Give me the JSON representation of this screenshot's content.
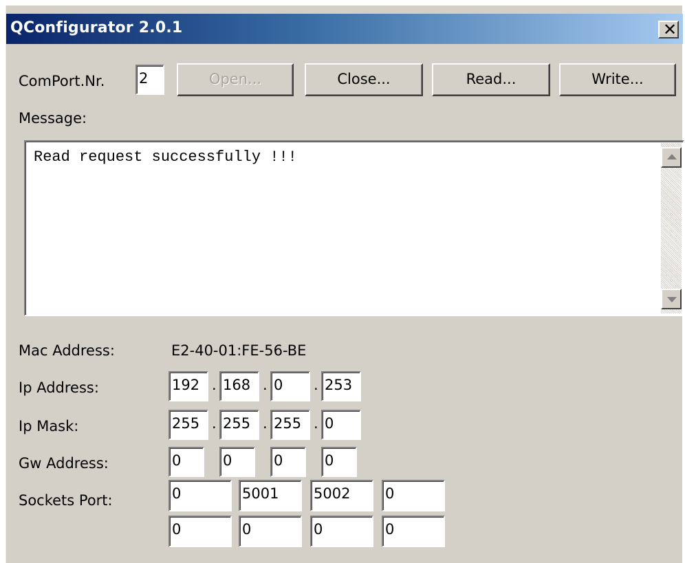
{
  "window": {
    "title": "QConfigurator 2.0.1",
    "close_glyph": "✕"
  },
  "com": {
    "label": "ComPort.Nr.",
    "value": "2",
    "buttons": {
      "open": "Open...",
      "close": "Close...",
      "read": "Read...",
      "write": "Write..."
    }
  },
  "message": {
    "label": "Message:",
    "text": "Read request successfully !!!"
  },
  "mac": {
    "label": "Mac Address:",
    "value": "E2-40-01:FE-56-BE"
  },
  "ip": {
    "label": "Ip Address:",
    "octets": [
      "192",
      "168",
      "0",
      "253"
    ]
  },
  "mask": {
    "label": "Ip Mask:",
    "octets": [
      "255",
      "255",
      "255",
      "0"
    ]
  },
  "gw": {
    "label": "Gw Address:",
    "octets": [
      "0",
      "0",
      "0",
      "0"
    ]
  },
  "sockets": {
    "label": "Sockets Port:",
    "row1": [
      "0",
      "5001",
      "5002",
      "0"
    ],
    "row2": [
      "0",
      "0",
      "0",
      "0"
    ]
  },
  "separator": "."
}
